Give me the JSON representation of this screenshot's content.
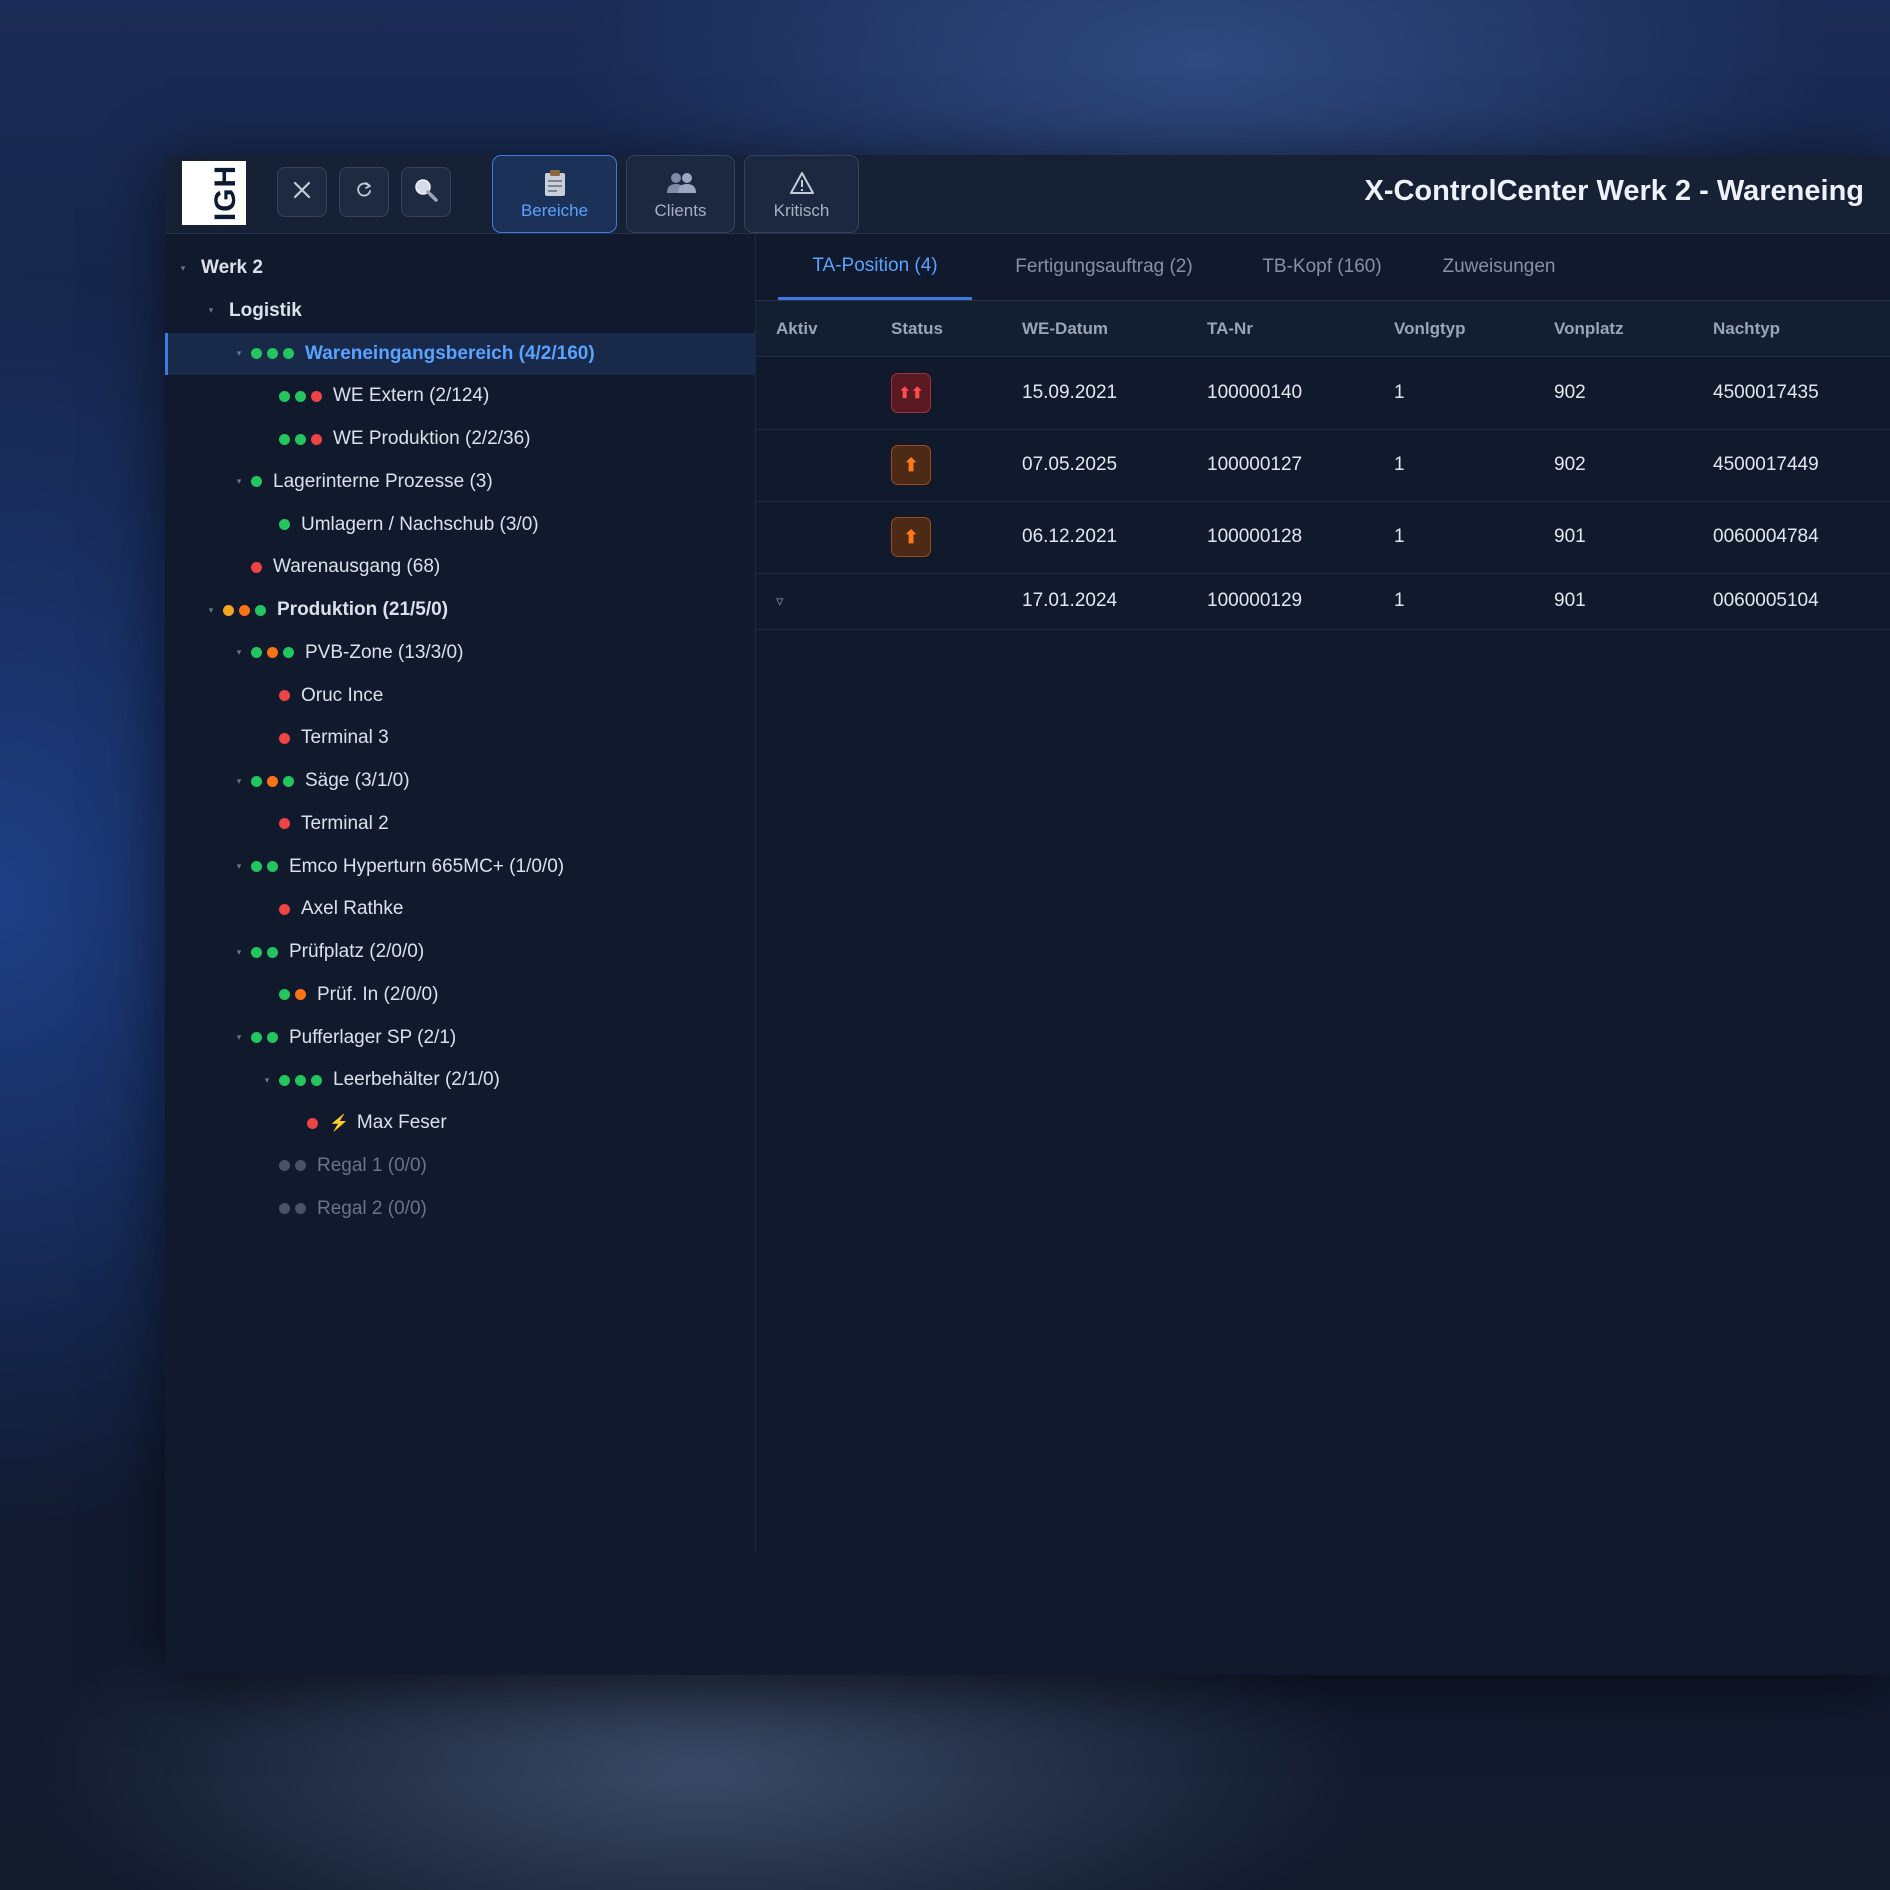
{
  "app": {
    "logo_text": "IGH",
    "title": "X-ControlCenter Werk 2 - Wareneing"
  },
  "toolbar": {
    "close_icon": "close-icon",
    "refresh_icon": "refresh-icon",
    "search_icon": "search-icon",
    "nav": [
      {
        "label": "Bereiche",
        "icon": "clipboard-icon",
        "active": true
      },
      {
        "label": "Clients",
        "icon": "users-icon",
        "active": false
      },
      {
        "label": "Kritisch",
        "icon": "warning-icon",
        "active": false
      }
    ]
  },
  "tree": [
    {
      "label": "Werk 2",
      "level": 0,
      "caret": true,
      "dots": [],
      "bold": true
    },
    {
      "label": "Logistik",
      "level": 1,
      "caret": true,
      "dots": [],
      "bold": true
    },
    {
      "label": "Wareneingangsbereich (4/2/160)",
      "level": 2,
      "caret": true,
      "dots": [
        "g",
        "g",
        "g"
      ],
      "selected": true
    },
    {
      "label": "WE Extern (2/124)",
      "level": 3,
      "caret": false,
      "dots": [
        "g",
        "g",
        "r"
      ]
    },
    {
      "label": "WE Produktion (2/2/36)",
      "level": 3,
      "caret": false,
      "dots": [
        "g",
        "g",
        "r"
      ]
    },
    {
      "label": "Lagerinterne Prozesse (3)",
      "level": 2,
      "caret": true,
      "dots": [
        "g"
      ]
    },
    {
      "label": "Umlagern / Nachschub (3/0)",
      "level": 3,
      "caret": false,
      "dots": [
        "g"
      ]
    },
    {
      "label": "Warenausgang (68)",
      "level": 2,
      "caret": false,
      "dots": [
        "r"
      ]
    },
    {
      "label": "Produktion (21/5/0)",
      "level": 1,
      "caret": true,
      "dots": [
        "y",
        "o",
        "g"
      ],
      "bold": true
    },
    {
      "label": "PVB-Zone (13/3/0)",
      "level": 2,
      "caret": true,
      "dots": [
        "g",
        "o",
        "g"
      ]
    },
    {
      "label": "Oruc Ince",
      "level": 3,
      "caret": false,
      "dots": [
        "r"
      ]
    },
    {
      "label": "Terminal 3",
      "level": 3,
      "caret": false,
      "dots": [
        "r"
      ]
    },
    {
      "label": "Säge (3/1/0)",
      "level": 2,
      "caret": true,
      "dots": [
        "g",
        "o",
        "g"
      ]
    },
    {
      "label": "Terminal 2",
      "level": 3,
      "caret": false,
      "dots": [
        "r"
      ]
    },
    {
      "label": "Emco Hyperturn 665MC+ (1/0/0)",
      "level": 2,
      "caret": true,
      "dots": [
        "g",
        "g"
      ]
    },
    {
      "label": "Axel Rathke",
      "level": 3,
      "caret": false,
      "dots": [
        "r"
      ]
    },
    {
      "label": "Prüfplatz (2/0/0)",
      "level": 2,
      "caret": true,
      "dots": [
        "g",
        "g"
      ]
    },
    {
      "label": "Prüf. In (2/0/0)",
      "level": 3,
      "caret": false,
      "dots": [
        "g",
        "o"
      ]
    },
    {
      "label": "Pufferlager SP (2/1)",
      "level": 2,
      "caret": true,
      "dots": [
        "g",
        "g"
      ]
    },
    {
      "label": "Leerbehälter (2/1/0)",
      "level": 3,
      "caret": true,
      "dots": [
        "g",
        "g",
        "g"
      ]
    },
    {
      "label": "Max Feser",
      "level": 4,
      "caret": false,
      "dots": [
        "r"
      ],
      "bolt": true
    },
    {
      "label": "Regal 1 (0/0)",
      "level": 3,
      "caret": false,
      "dots": [
        "n",
        "n"
      ],
      "dim": true
    },
    {
      "label": "Regal 2 (0/0)",
      "level": 3,
      "caret": false,
      "dots": [
        "n",
        "n"
      ],
      "dim": true
    }
  ],
  "tabs": [
    {
      "label": "TA-Position (4)",
      "active": true
    },
    {
      "label": "Fertigungsauftrag (2)",
      "active": false
    },
    {
      "label": "TB-Kopf (160)",
      "active": false
    },
    {
      "label": "Zuweisungen",
      "active": false
    }
  ],
  "table": {
    "columns": [
      "Aktiv",
      "Status",
      "WE-Datum",
      "TA-Nr",
      "Vonlgtyp",
      "Vonplatz",
      "Nachtyp"
    ],
    "rows": [
      {
        "aktiv": "",
        "status": "double-up-arrow",
        "we_datum": "15.09.2021",
        "ta_nr": "100000140",
        "vonlgtyp": "1",
        "vonplatz": "902",
        "nachtyp": "4500017435"
      },
      {
        "aktiv": "",
        "status": "up-arrow",
        "we_datum": "07.05.2025",
        "ta_nr": "100000127",
        "vonlgtyp": "1",
        "vonplatz": "902",
        "nachtyp": "4500017449"
      },
      {
        "aktiv": "",
        "status": "up-arrow",
        "we_datum": "06.12.2021",
        "ta_nr": "100000128",
        "vonlgtyp": "1",
        "vonplatz": "901",
        "nachtyp": "0060004784"
      },
      {
        "aktiv": "▿",
        "status": "",
        "we_datum": "17.01.2024",
        "ta_nr": "100000129",
        "vonlgtyp": "1",
        "vonplatz": "901",
        "nachtyp": "0060005104"
      }
    ]
  },
  "colors": {
    "accent": "#3e7be0",
    "ok": "#22c55e",
    "error": "#ef4444",
    "warning": "#f97316",
    "pending": "#f5a524"
  }
}
